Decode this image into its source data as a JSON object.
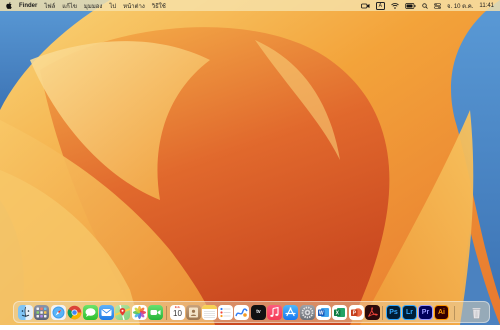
{
  "menubar": {
    "apple_icon": "apple-icon",
    "app_name": "Finder",
    "menus": [
      "ไฟล์",
      "แก้ไข",
      "มุมมอง",
      "ไป",
      "หน้าต่าง",
      "วิธีใช้"
    ],
    "status_icons": [
      "camera-icon",
      "input-source-icon",
      "wifi-icon",
      "battery-icon",
      "search-icon",
      "control-center-icon"
    ],
    "input_source_label": "A",
    "date": "จ. 10 ต.ค.",
    "time": "11:41"
  },
  "wallpaper": {
    "name": "macOS Ventura",
    "colors": {
      "orange": "#f3a33a",
      "deep_orange": "#d9592a",
      "yellow": "#f9d67a",
      "blue": "#4a86c5"
    }
  },
  "dock": {
    "calendar_day": "10",
    "calendar_month": "ต.ค.",
    "items": [
      {
        "name": "Finder",
        "icon": "finder-icon"
      },
      {
        "name": "Launchpad",
        "icon": "launchpad-icon"
      },
      {
        "name": "Safari",
        "icon": "safari-icon"
      },
      {
        "name": "Google Chrome",
        "icon": "chrome-icon"
      },
      {
        "name": "Messages",
        "icon": "messages-icon"
      },
      {
        "name": "Mail",
        "icon": "mail-icon"
      },
      {
        "name": "Maps",
        "icon": "maps-icon"
      },
      {
        "name": "Photos",
        "icon": "photos-icon"
      },
      {
        "name": "FaceTime",
        "icon": "facetime-icon"
      },
      {
        "name": "Calendar",
        "icon": "calendar-icon"
      },
      {
        "name": "Contacts",
        "icon": "contacts-icon"
      },
      {
        "name": "Notes",
        "icon": "notes-icon"
      },
      {
        "name": "Reminders",
        "icon": "reminders-icon"
      },
      {
        "name": "Freeform",
        "icon": "freeform-icon"
      },
      {
        "name": "Apple TV",
        "icon": "apple-tv-icon"
      },
      {
        "name": "Music",
        "icon": "music-icon"
      },
      {
        "name": "App Store",
        "icon": "app-store-icon"
      },
      {
        "name": "System Settings",
        "icon": "system-settings-icon"
      },
      {
        "name": "Microsoft Word",
        "icon": "word-icon"
      },
      {
        "name": "Microsoft Excel",
        "icon": "excel-icon"
      },
      {
        "name": "Microsoft PowerPoint",
        "icon": "powerpoint-icon"
      },
      {
        "name": "Adobe Acrobat",
        "icon": "acrobat-icon"
      },
      {
        "name": "Adobe Photoshop",
        "icon": "photoshop-icon",
        "label": "Ps"
      },
      {
        "name": "Adobe Lightroom",
        "icon": "lightroom-icon",
        "label": "Lr"
      },
      {
        "name": "Adobe Premiere Pro",
        "icon": "premiere-icon",
        "label": "Pr"
      },
      {
        "name": "Adobe Illustrator",
        "icon": "illustrator-icon",
        "label": "Ai"
      },
      {
        "name": "Trash",
        "icon": "trash-icon"
      }
    ]
  }
}
